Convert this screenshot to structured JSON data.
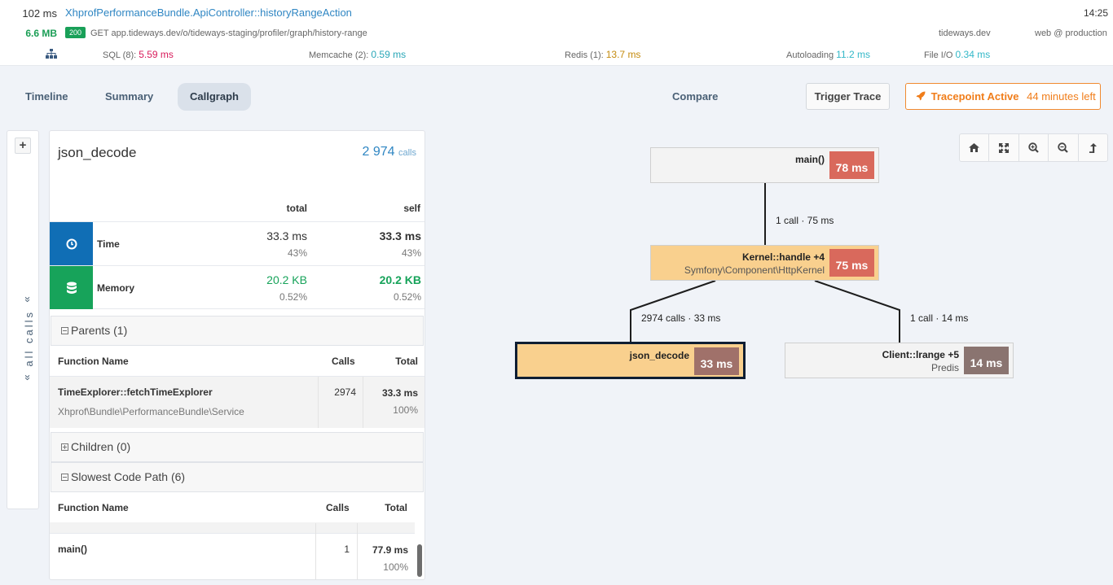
{
  "header": {
    "duration": "102 ms",
    "title": "XhprofPerformanceBundle.ApiController::historyRangeAction",
    "time": "14:25",
    "memory": "6.6 MB",
    "status_code": "200",
    "request": "GET app.tideways.dev/o/tideways-staging/profiler/graph/history-range",
    "host": "tideways.dev",
    "environment": "web @ production",
    "metrics": {
      "sql": {
        "label": "SQL (8):",
        "value": "5.59 ms",
        "color": "#d81b5b"
      },
      "memcache": {
        "label": "Memcache (2):",
        "value": "0.59 ms",
        "color": "#2aa7b8"
      },
      "redis": {
        "label": "Redis (1):",
        "value": "13.7 ms",
        "color": "#c48b0f"
      },
      "autoloading": {
        "label": "Autoloading",
        "value": "11.2 ms",
        "color": "#33b8c8"
      },
      "file_io": {
        "label": "File I/O",
        "value": "0.34 ms",
        "color": "#33b8c8"
      }
    }
  },
  "tabs": [
    {
      "label": "Timeline",
      "active": false
    },
    {
      "label": "Summary",
      "active": false
    },
    {
      "label": "Callgraph",
      "active": true
    },
    {
      "label": "Compare",
      "active": false
    }
  ],
  "actions": {
    "trigger_trace": "Trigger Trace",
    "tracepoint_label": "Tracepoint Active",
    "tracepoint_time": "44 minutes left"
  },
  "rail": {
    "expand": "+",
    "label": "all calls",
    "chevron": "»"
  },
  "detail": {
    "function": "json_decode",
    "calls_count": "2 974",
    "calls_unit": "calls",
    "col_total": "total",
    "col_self": "self",
    "time": {
      "label": "Time",
      "total": "33.3 ms",
      "total_pct": "43%",
      "self": "33.3 ms",
      "self_pct": "43%"
    },
    "memory": {
      "label": "Memory",
      "total": "20.2 KB",
      "total_pct": "0.52%",
      "self": "20.2 KB",
      "self_pct": "0.52%"
    },
    "parents": {
      "title": "Parents (1)",
      "columns": [
        "Function Name",
        "Calls",
        "Total"
      ],
      "rows": [
        {
          "function": "TimeExplorer::fetchTimeExplorer",
          "namespace": "Xhprof\\Bundle\\PerformanceBundle\\Service",
          "calls": "2974",
          "total": "33.3 ms",
          "pct": "100%"
        }
      ]
    },
    "children": {
      "title": "Children (0)"
    },
    "slowest": {
      "title": "Slowest Code Path (6)",
      "columns": [
        "Function Name",
        "Calls",
        "Total"
      ],
      "rows": [
        {
          "function": "main()",
          "calls": "1",
          "total": "77.9 ms",
          "pct": "100%"
        }
      ]
    }
  },
  "graph": {
    "nodes": [
      {
        "id": "main",
        "name": "main()",
        "namespace": "",
        "cost": "78 ms",
        "cost_color": "#d9695c",
        "bg": "#f3f3f3",
        "selected": false
      },
      {
        "id": "kernel",
        "name": "Kernel::handle +4",
        "namespace": "Symfony\\Component\\HttpKernel",
        "cost": "75 ms",
        "cost_color": "#d9695c",
        "bg": "#f9d08e",
        "selected": false
      },
      {
        "id": "json",
        "name": "json_decode",
        "namespace": "",
        "cost": "33 ms",
        "cost_color": "#a0716a",
        "bg": "#f9d08e",
        "selected": true
      },
      {
        "id": "client",
        "name": "Client::lrange +5",
        "namespace": "Predis",
        "cost": "14 ms",
        "cost_color": "#8a7470",
        "bg": "#f3f3f3",
        "selected": false
      }
    ],
    "edges": [
      {
        "from": "main",
        "to": "kernel",
        "label": "1 call · 75 ms"
      },
      {
        "from": "kernel",
        "to": "json",
        "label": "2974 calls · 33 ms"
      },
      {
        "from": "kernel",
        "to": "client",
        "label": "1 call · 14 ms"
      }
    ]
  }
}
